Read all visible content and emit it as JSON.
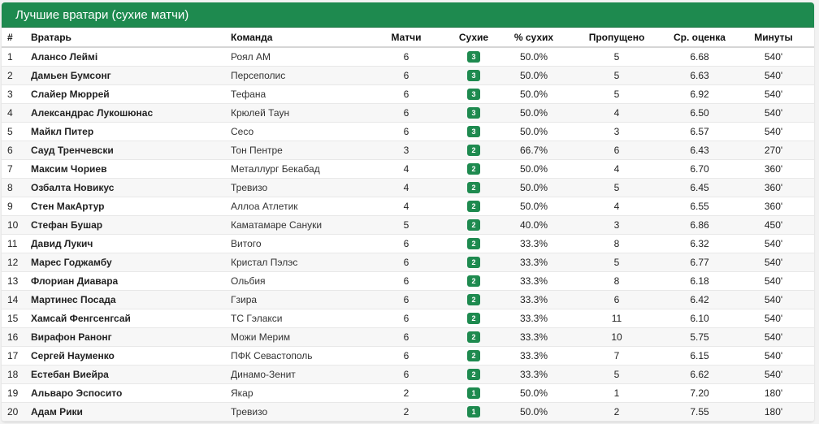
{
  "title": "Лучшие вратари (сухие матчи)",
  "accent_color": "#1e8a4f",
  "columns": {
    "num": "#",
    "player": "Вратарь",
    "team": "Команда",
    "matches": "Матчи",
    "clean": "Сухие",
    "pct": "% сухих",
    "conceded": "Пропущено",
    "rating": "Ср. оценка",
    "minutes": "Минуты"
  },
  "rows": [
    {
      "num": "1",
      "player": "Алансо Леймі",
      "team": "Роял АМ",
      "matches": "6",
      "clean": "3",
      "pct": "50.0%",
      "conceded": "5",
      "rating": "6.68",
      "minutes": "540'"
    },
    {
      "num": "2",
      "player": "Дамьен Бумсонг",
      "team": "Персеполис",
      "matches": "6",
      "clean": "3",
      "pct": "50.0%",
      "conceded": "5",
      "rating": "6.63",
      "minutes": "540'"
    },
    {
      "num": "3",
      "player": "Слайер Мюррей",
      "team": "Тефана",
      "matches": "6",
      "clean": "3",
      "pct": "50.0%",
      "conceded": "5",
      "rating": "6.92",
      "minutes": "540'"
    },
    {
      "num": "4",
      "player": "Александрас Лукошюнас",
      "team": "Крюлей Таун",
      "matches": "6",
      "clean": "3",
      "pct": "50.0%",
      "conceded": "4",
      "rating": "6.50",
      "minutes": "540'"
    },
    {
      "num": "5",
      "player": "Майкл Питер",
      "team": "Сесо",
      "matches": "6",
      "clean": "3",
      "pct": "50.0%",
      "conceded": "3",
      "rating": "6.57",
      "minutes": "540'"
    },
    {
      "num": "6",
      "player": "Сауд Тренчевски",
      "team": "Тон Пентре",
      "matches": "3",
      "clean": "2",
      "pct": "66.7%",
      "conceded": "6",
      "rating": "6.43",
      "minutes": "270'"
    },
    {
      "num": "7",
      "player": "Максим Чориев",
      "team": "Металлург Бекабад",
      "matches": "4",
      "clean": "2",
      "pct": "50.0%",
      "conceded": "4",
      "rating": "6.70",
      "minutes": "360'"
    },
    {
      "num": "8",
      "player": "Озбалта Новикус",
      "team": "Тревизо",
      "matches": "4",
      "clean": "2",
      "pct": "50.0%",
      "conceded": "5",
      "rating": "6.45",
      "minutes": "360'"
    },
    {
      "num": "9",
      "player": "Стен МакАртур",
      "team": "Аллоа Атлетик",
      "matches": "4",
      "clean": "2",
      "pct": "50.0%",
      "conceded": "4",
      "rating": "6.55",
      "minutes": "360'"
    },
    {
      "num": "10",
      "player": "Стефан Бушар",
      "team": "Каматамаре Сануки",
      "matches": "5",
      "clean": "2",
      "pct": "40.0%",
      "conceded": "3",
      "rating": "6.86",
      "minutes": "450'"
    },
    {
      "num": "11",
      "player": "Давид Лукич",
      "team": "Витого",
      "matches": "6",
      "clean": "2",
      "pct": "33.3%",
      "conceded": "8",
      "rating": "6.32",
      "minutes": "540'"
    },
    {
      "num": "12",
      "player": "Марес Годжамбу",
      "team": "Кристал Пэлэс",
      "matches": "6",
      "clean": "2",
      "pct": "33.3%",
      "conceded": "5",
      "rating": "6.77",
      "minutes": "540'"
    },
    {
      "num": "13",
      "player": "Флориан Диавара",
      "team": "Ольбия",
      "matches": "6",
      "clean": "2",
      "pct": "33.3%",
      "conceded": "8",
      "rating": "6.18",
      "minutes": "540'"
    },
    {
      "num": "14",
      "player": "Мартинес Посада",
      "team": "Гзира",
      "matches": "6",
      "clean": "2",
      "pct": "33.3%",
      "conceded": "6",
      "rating": "6.42",
      "minutes": "540'"
    },
    {
      "num": "15",
      "player": "Хамсай Фенгсенгсай",
      "team": "ТС Гэлакси",
      "matches": "6",
      "clean": "2",
      "pct": "33.3%",
      "conceded": "11",
      "rating": "6.10",
      "minutes": "540'"
    },
    {
      "num": "16",
      "player": "Вирафон Ранонг",
      "team": "Можи Мерим",
      "matches": "6",
      "clean": "2",
      "pct": "33.3%",
      "conceded": "10",
      "rating": "5.75",
      "minutes": "540'"
    },
    {
      "num": "17",
      "player": "Сергей Науменко",
      "team": "ПФК Севастополь",
      "matches": "6",
      "clean": "2",
      "pct": "33.3%",
      "conceded": "7",
      "rating": "6.15",
      "minutes": "540'"
    },
    {
      "num": "18",
      "player": "Естебан Виейра",
      "team": "Динамо-Зенит",
      "matches": "6",
      "clean": "2",
      "pct": "33.3%",
      "conceded": "5",
      "rating": "6.62",
      "minutes": "540'"
    },
    {
      "num": "19",
      "player": "Альваро Эспосито",
      "team": "Якар",
      "matches": "2",
      "clean": "1",
      "pct": "50.0%",
      "conceded": "1",
      "rating": "7.20",
      "minutes": "180'"
    },
    {
      "num": "20",
      "player": "Адам Рики",
      "team": "Тревизо",
      "matches": "2",
      "clean": "1",
      "pct": "50.0%",
      "conceded": "2",
      "rating": "7.55",
      "minutes": "180'"
    }
  ]
}
